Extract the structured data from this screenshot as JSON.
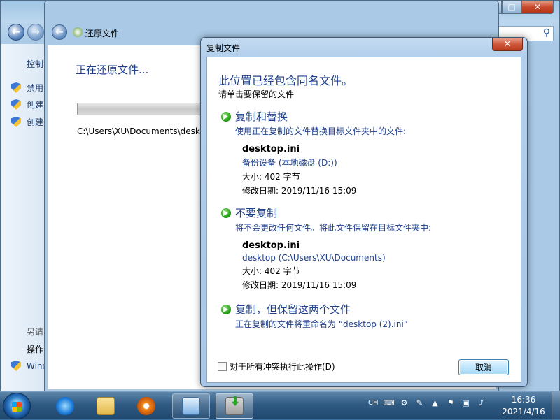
{
  "back_window": {
    "sidebar": {
      "control_label": "控制",
      "items": [
        "禁用",
        "创建",
        "创建"
      ],
      "see_also": "另请",
      "operation": "操作",
      "windows": "Wind"
    }
  },
  "restore_window": {
    "title": "还原文件",
    "heading": "正在还原文件...",
    "path": "C:\\Users\\XU\\Documents\\deskt"
  },
  "dialog": {
    "title": "复制文件",
    "close_label": "✕",
    "heading": "此位置已经包含同名文件。",
    "subheading": "请单击要保留的文件",
    "options": [
      {
        "title": "复制和替换",
        "desc": "使用正在复制的文件替换目标文件夹中的文件:",
        "file": {
          "name": "desktop.ini",
          "location": "备份设备 (本地磁盘 (D:))",
          "size": "大小: 402 字节",
          "modified": "修改日期: 2019/11/16 15:09"
        }
      },
      {
        "title": "不要复制",
        "desc": "将不会更改任何文件。将此文件保留在目标文件夹中:",
        "file": {
          "name": "desktop.ini",
          "location": "desktop (C:\\Users\\XU\\Documents)",
          "size": "大小: 402 字节",
          "modified": "修改日期: 2019/11/16 15:09"
        }
      },
      {
        "title": "复制，但保留这两个文件",
        "desc": "正在复制的文件将重命名为 “desktop (2).ini”"
      }
    ],
    "checkbox_label": "对于所有冲突执行此操作(D)",
    "cancel_label": "取消"
  },
  "taskbar": {
    "lang": "CH",
    "time": "16:36",
    "date": "2021/4/16",
    "apps": [
      "start-orb",
      "internet-explorer",
      "file-explorer",
      "media-player",
      "control-panel",
      "file-copy"
    ]
  },
  "colors": {
    "accent_text": "#1e3f8c",
    "dialog_frame": "#a8c7e6",
    "taskbar": "#2f5a82",
    "close_red": "#cf5a3c"
  }
}
